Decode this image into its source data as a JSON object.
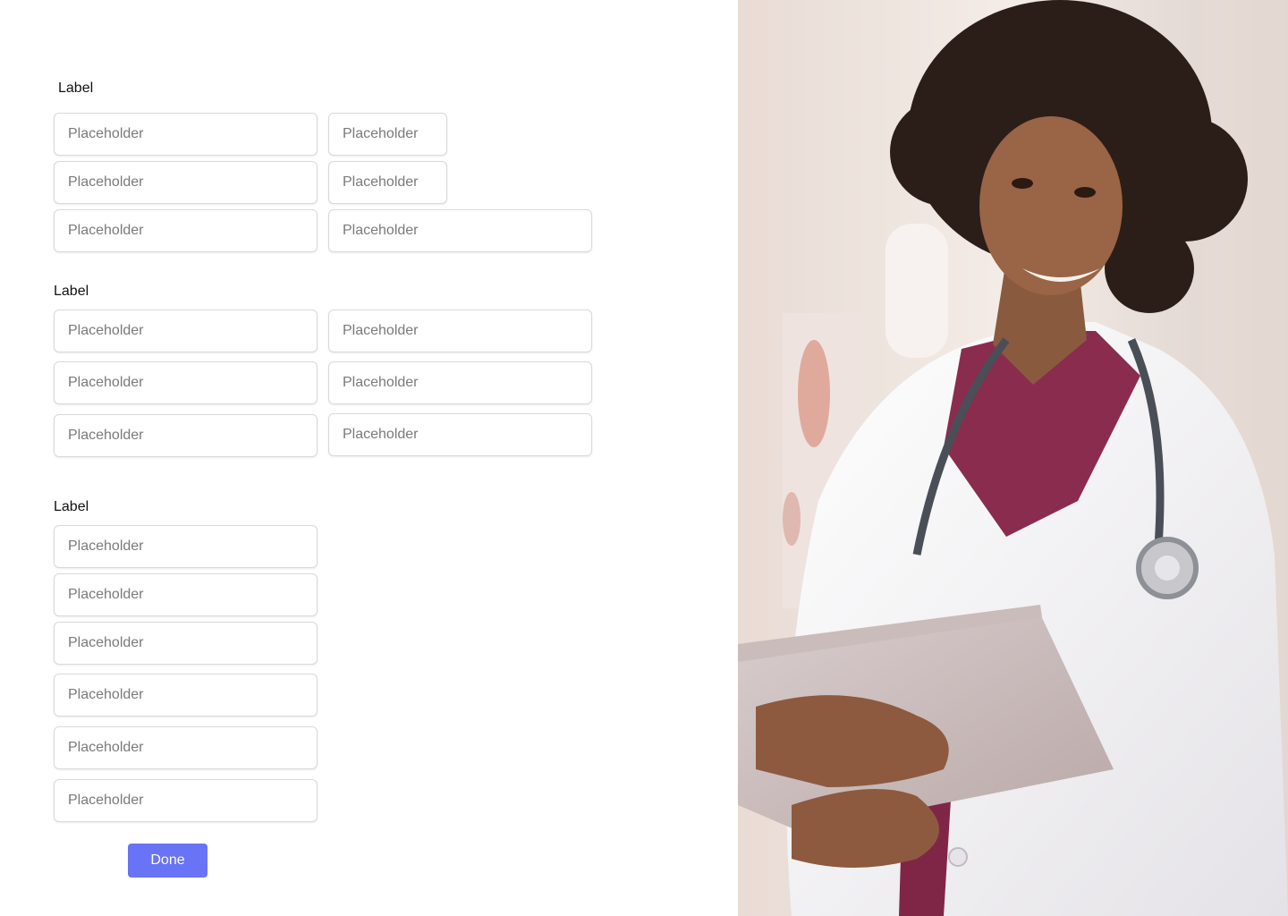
{
  "sections": [
    {
      "label": "Label"
    },
    {
      "label": "Label"
    },
    {
      "label": "Label"
    }
  ],
  "fields": {
    "placeholder": "Placeholder"
  },
  "actions": {
    "done_label": "Done"
  },
  "colors": {
    "accent": "#6874f5",
    "border": "#d9d9d9",
    "placeholder": "#7a7a7a"
  },
  "photo": {
    "subject": "doctor-holding-clipboard"
  }
}
